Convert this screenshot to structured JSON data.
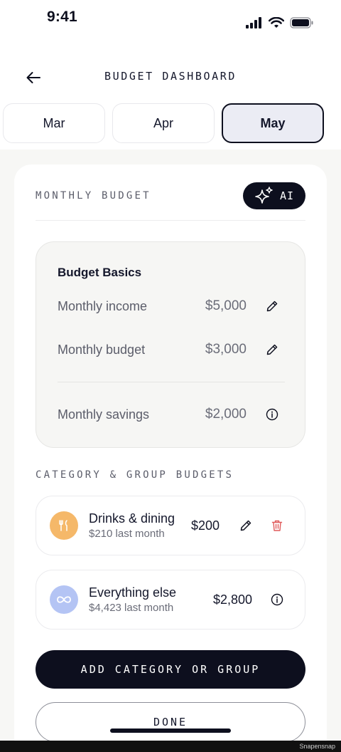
{
  "status_bar": {
    "time": "9:41"
  },
  "header": {
    "title": "BUDGET DASHBOARD"
  },
  "tabs": [
    {
      "label": "Mar",
      "active": false
    },
    {
      "label": "Apr",
      "active": false
    },
    {
      "label": "May",
      "active": true
    }
  ],
  "monthly_budget": {
    "section_title": "MONTHLY BUDGET",
    "ai_label": "AI",
    "basics": {
      "title": "Budget Basics",
      "rows": [
        {
          "label": "Monthly income",
          "value": "$5,000",
          "icon": "pencil-icon"
        },
        {
          "label": "Monthly budget",
          "value": "$3,000",
          "icon": "pencil-icon"
        },
        {
          "label": "Monthly savings",
          "value": "$2,000",
          "icon": "info-icon"
        }
      ]
    }
  },
  "categories": {
    "section_title": "CATEGORY & GROUP BUDGETS",
    "items": [
      {
        "name": "Drinks & dining",
        "sub": "$210 last month",
        "amount": "$200",
        "icon": "fork-knife-icon",
        "icon_color": "#f5b869"
      },
      {
        "name": "Everything else",
        "sub": "$4,423 last month",
        "amount": "$2,800",
        "icon": "infinity-icon",
        "icon_color": "#b4c4f4"
      }
    ]
  },
  "actions": {
    "add_label": "ADD CATEGORY OR GROUP",
    "done_label": "DONE"
  },
  "watermark": "Snapensnap",
  "colors": {
    "primary": "#0d0f1e",
    "delete": "#e05a5a",
    "tab_active_bg": "#ebecf4"
  }
}
